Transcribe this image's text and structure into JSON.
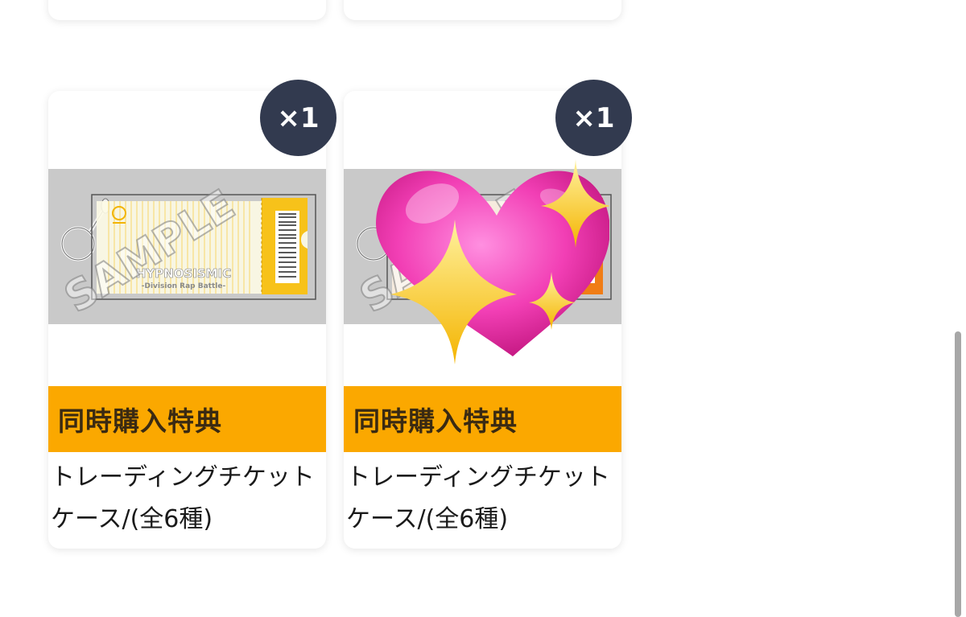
{
  "products": [
    {
      "quantity_badge": "×1",
      "ribbon": "同時購入特典",
      "name": "トレーディングチケットケース/(全6種)",
      "image": {
        "logo_title": "HYPNOSISMIC",
        "logo_subtitle": "-Division Rap Battle-",
        "watermark": "SAMPLE",
        "ticket_color": "#f7c21a"
      },
      "sticker": null
    },
    {
      "quantity_badge": "×1",
      "ribbon": "同時購入特典",
      "name": "トレーディングチケットケース/(全6種)",
      "image": {
        "watermark": "SAMPLE",
        "ticket_color": "#f07d16"
      },
      "sticker": "sparkling-heart-emoji"
    }
  ],
  "colors": {
    "badge_bg": "#323a4f",
    "ribbon_bg": "#fba800",
    "image_bg": "#c9c9c9"
  }
}
